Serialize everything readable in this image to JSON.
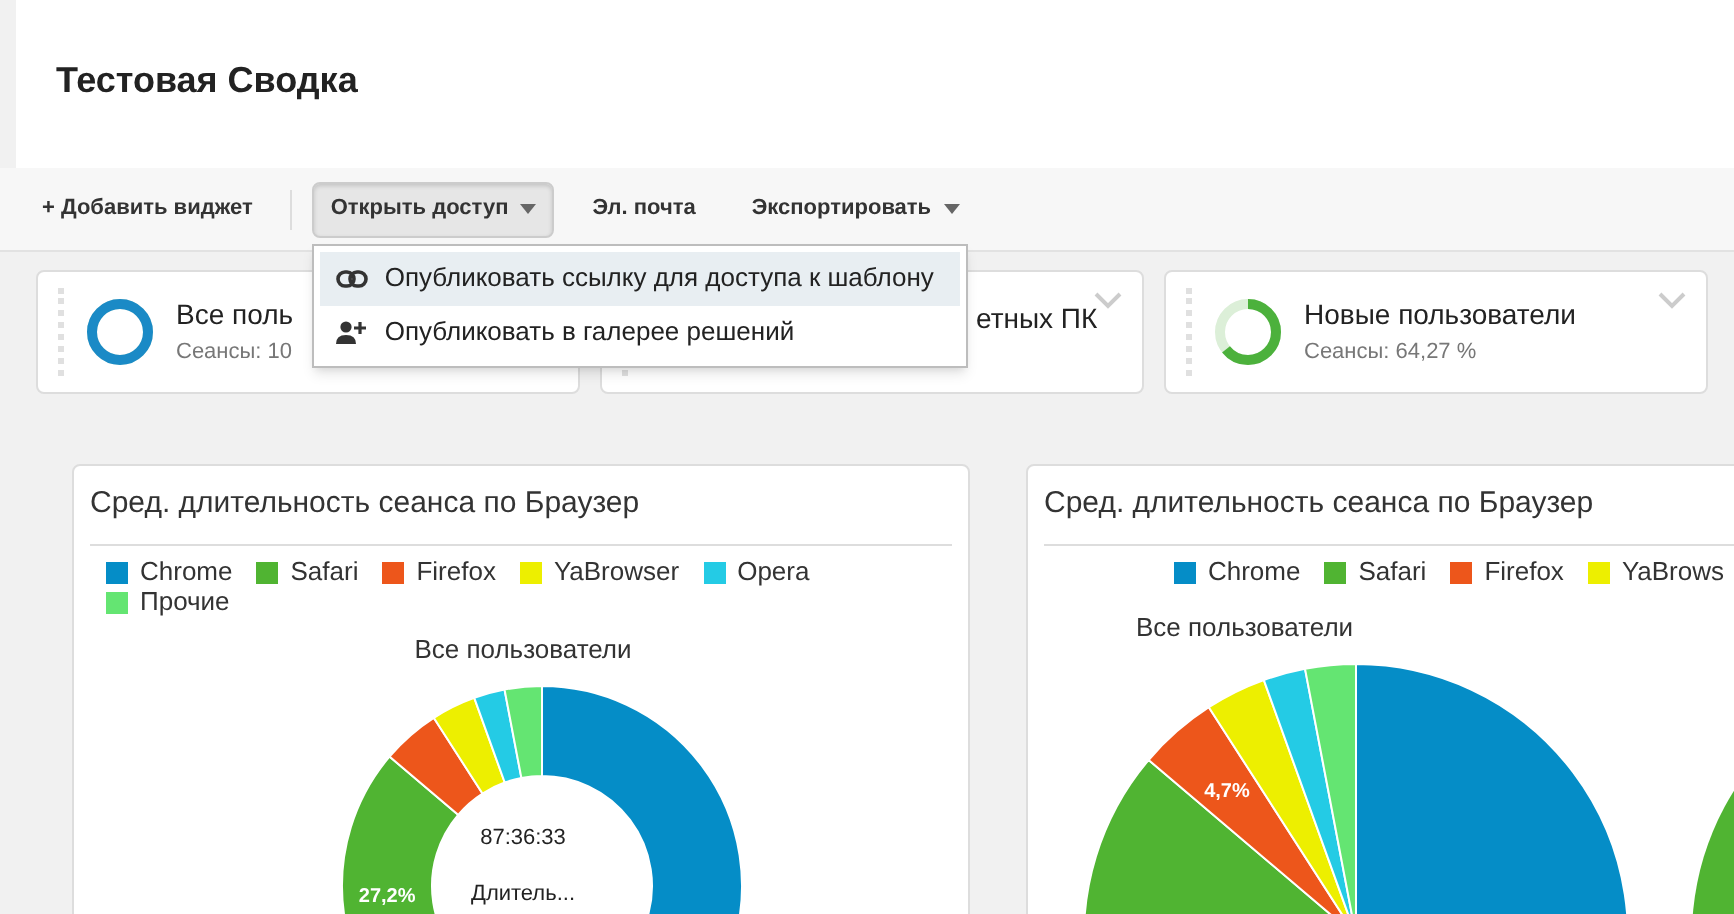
{
  "page": {
    "title": "Тестовая Сводка"
  },
  "toolbar": [
    {
      "label": "+ Добавить виджет",
      "kind": "button",
      "open": false
    },
    {
      "label": "Открыть доступ",
      "kind": "dropdown",
      "open": true
    },
    {
      "label": "Эл. почта",
      "kind": "button",
      "open": false
    },
    {
      "label": "Экспортировать",
      "kind": "dropdown",
      "open": false
    }
  ],
  "share_menu": {
    "items": [
      {
        "label": "Опубликовать ссылку для доступа к шаблону",
        "selected": true
      },
      {
        "label": "Опубликовать в галерее решений",
        "selected": false
      }
    ]
  },
  "scorecards": [
    {
      "title": "Все поль",
      "subtitle": "Сеансы: 10",
      "level": 1,
      "color": "#1a8ac6"
    },
    {
      "title": "етных ПК"
    },
    {
      "title": "Новые пользователи",
      "subtitle": "Сеансы: 64,27 %",
      "level": 0.6427,
      "color": "#4cb13c"
    }
  ],
  "charts": [
    {
      "title": "Сред. длительность сеанса по Браузер",
      "kind": "donut",
      "subtitle": "Все пользователи",
      "center_value": "87:36:33",
      "center_label": "Длитель...",
      "legend": [
        {
          "name": "Chrome",
          "color": "#058dc7"
        },
        {
          "name": "Safari",
          "color": "#50b432",
          "slice_label": "27,2%"
        },
        {
          "name": "Firefox",
          "color": "#ed561b"
        },
        {
          "name": "YaBrowser",
          "color": "#edef00"
        },
        {
          "name": "Opera",
          "color": "#24cbe5"
        },
        {
          "name": "Прочие",
          "color": "#64e572"
        }
      ]
    },
    {
      "title": "Сред. длительность сеанса по Браузер",
      "kind": "pie",
      "subtitle": "Все пользователи",
      "legend": [
        {
          "name": "Chrome",
          "color": "#058dc7"
        },
        {
          "name": "Safari",
          "color": "#50b432"
        },
        {
          "name": "Firefox",
          "color": "#ed561b",
          "slice_label": "4,7%"
        },
        {
          "name": "YaBrows",
          "color": "#edef00"
        }
      ]
    }
  ]
}
